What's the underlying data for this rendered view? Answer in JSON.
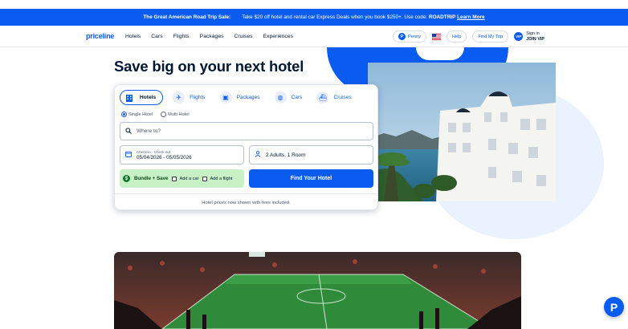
{
  "promo": {
    "title": "The Great American Road Trip Sale:",
    "text": "Take $20 off hotel and rental car Express Deals when you book $250+. Use code:",
    "code": "ROADTRIP",
    "link": "Learn More"
  },
  "header": {
    "logo": "priceline",
    "nav": [
      "Hotels",
      "Cars",
      "Flights",
      "Packages",
      "Cruises",
      "Experiences"
    ],
    "penny": "Penny",
    "help": "Help",
    "find_trip": "Find My Trip",
    "avatar_initials": "VIP",
    "sign_in": "Sign in",
    "tier": "JOIN VIP"
  },
  "hero": {
    "headline": "Save big on your next hotel"
  },
  "search": {
    "tabs": [
      {
        "label": "Hotels",
        "icon": "hotel-icon",
        "active": true
      },
      {
        "label": "Flights",
        "icon": "plane-icon",
        "active": false
      },
      {
        "label": "Packages",
        "icon": "package-icon",
        "active": false
      },
      {
        "label": "Cars",
        "icon": "car-icon",
        "active": false
      },
      {
        "label": "Cruises",
        "icon": "cruise-icon",
        "active": false
      }
    ],
    "radio_single": "Single Hotel",
    "radio_multi": "Multi Hotel",
    "where_placeholder": "Where to?",
    "dates_label": "Check-in - Check-out",
    "dates_value": "05/04/2026 - 05/05/2026",
    "guests_value": "2 Adults, 1 Room",
    "bundle_title": "Bundle + Save",
    "add_car": "Add a car",
    "add_flight": "Add a flight",
    "submit": "Find Your Hotel",
    "fees_note": "Hotel prices now shown with fees included."
  },
  "chat": {
    "fab_letter": "P"
  },
  "colors": {
    "brand": "#0a5cf0",
    "text": "#001833",
    "bundle_bg": "#c8f1c6"
  }
}
